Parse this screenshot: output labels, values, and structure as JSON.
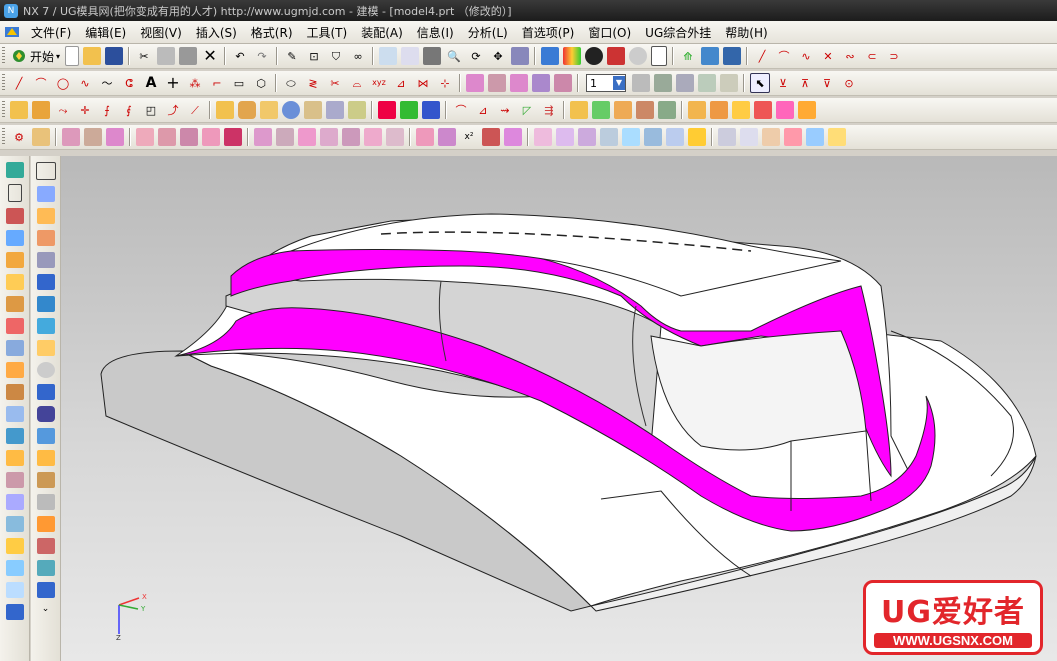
{
  "window": {
    "title": "NX 7 / UG模具网(把你变成有用的人才) http://www.ugmjd.com - 建模 - [model4.prt （修改的）]",
    "app_icon": "nx-logo-icon"
  },
  "menu": {
    "items": [
      "文件(F)",
      "编辑(E)",
      "视图(V)",
      "插入(S)",
      "格式(R)",
      "工具(T)",
      "装配(A)",
      "信息(I)",
      "分析(L)",
      "首选项(P)",
      "窗口(O)",
      "UG综合外挂",
      "帮助(H)"
    ]
  },
  "toolbar": {
    "start_label": "开始",
    "layer_value": "1"
  },
  "viewport": {
    "background_top": "#b9b9b9",
    "background_bottom": "#e8e8e8",
    "face_highlight_color": "#ff00ff",
    "body_color": "#ffffff",
    "side_color": "#c8c8c8"
  },
  "triad": {
    "x_label": "X",
    "y_label": "Y",
    "z_label": "Z"
  },
  "watermark": {
    "title": "UG爱好者",
    "url": "WWW.UGSNX.COM",
    "color": "#e2262b"
  }
}
